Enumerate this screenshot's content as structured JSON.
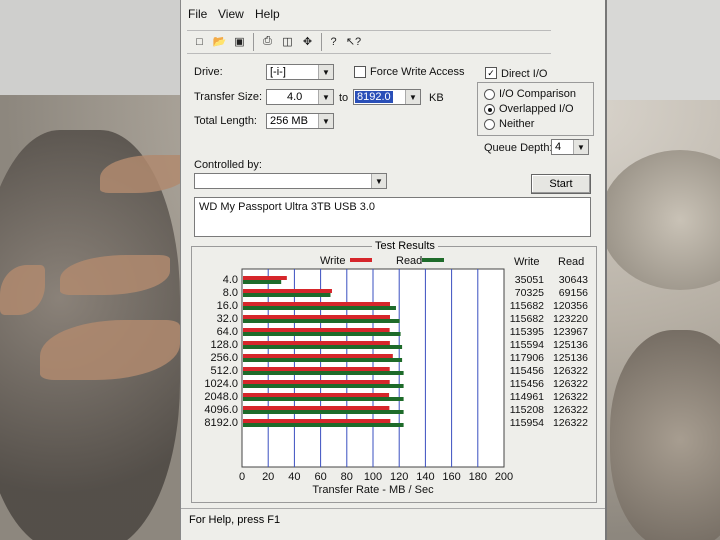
{
  "menu": {
    "file": "File",
    "view": "View",
    "help": "Help"
  },
  "toolbar": {
    "icons": [
      "new-icon",
      "open-icon",
      "save-icon",
      "print-icon",
      "print-preview-icon",
      "move-icon",
      "help-icon",
      "context-help-icon"
    ]
  },
  "form": {
    "drive_label": "Drive:",
    "drive_value": "[-i-]",
    "force_write_label": "Force Write Access",
    "force_write_checked": false,
    "direct_io_label": "Direct I/O",
    "direct_io_checked": true,
    "transfer_size_label": "Transfer Size:",
    "transfer_from": "4.0",
    "to_label": "to",
    "transfer_to": "8192.0",
    "kb_label": "KB",
    "total_length_label": "Total Length:",
    "total_length_value": "256 MB",
    "io_comparison_label": "I/O Comparison",
    "overlapped_io_label": "Overlapped I/O",
    "neither_label": "Neither",
    "selected_mode": "Overlapped I/O",
    "queue_depth_label": "Queue Depth:",
    "queue_depth_value": "4",
    "controlled_by_label": "Controlled by:",
    "controlled_by_value": "",
    "start_label": "Start",
    "description": "WD My Passport Ultra 3TB USB 3.0"
  },
  "results": {
    "title": "Test Results",
    "write_col": "Write",
    "read_col": "Read"
  },
  "chart_data": {
    "type": "bar",
    "orientation": "horizontal",
    "xlabel": "Transfer Rate - MB / Sec",
    "xlim": [
      0,
      200
    ],
    "xticks": [
      0,
      20,
      40,
      60,
      80,
      100,
      120,
      140,
      160,
      180,
      200
    ],
    "categories": [
      "4.0",
      "8.0",
      "16.0",
      "32.0",
      "64.0",
      "128.0",
      "256.0",
      "512.0",
      "1024.0",
      "2048.0",
      "4096.0",
      "8192.0"
    ],
    "series": [
      {
        "name": "Write",
        "color": "#d6262b",
        "values_kb": [
          35051,
          70325,
          115682,
          115682,
          115395,
          115594,
          117906,
          115456,
          115456,
          114961,
          115208,
          115954
        ]
      },
      {
        "name": "Read",
        "color": "#1e6b2a",
        "values_kb": [
          30643,
          69156,
          120356,
          123220,
          123967,
          125136,
          125136,
          126322,
          126322,
          126322,
          126322,
          126322
        ]
      }
    ],
    "legend": "top"
  },
  "status": {
    "text": "For Help, press F1"
  }
}
